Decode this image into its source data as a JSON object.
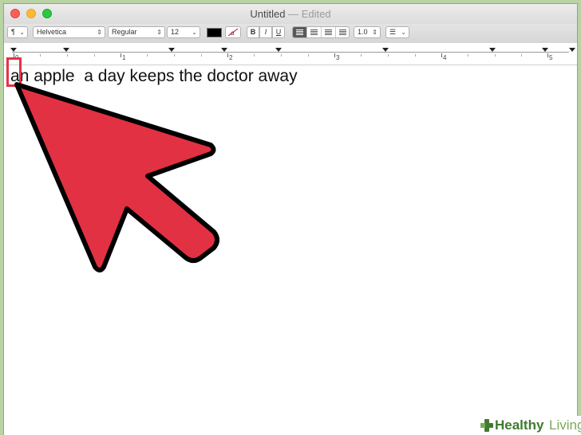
{
  "window": {
    "title": "Untitled",
    "title_separator": "—",
    "title_status": "Edited"
  },
  "toolbar": {
    "paragraph_styles_glyph": "¶",
    "font_family": "Helvetica",
    "font_style": "Regular",
    "font_size": "12",
    "bold_label": "B",
    "italic_label": "I",
    "underline_label": "U",
    "line_spacing": "1.0",
    "text_color": "#000000"
  },
  "ruler": {
    "numbers": [
      "0",
      "1",
      "2",
      "3",
      "4",
      "5"
    ]
  },
  "document": {
    "text_first_char": "a",
    "text_rest": "n apple  a day keeps the doctor away"
  },
  "annotation": {
    "arrow_color": "#e23142",
    "box_color": "#e63246"
  },
  "branding": {
    "name_bold": "Healthy",
    "name_light": "Living",
    "color_primary": "#3e7b2d",
    "color_secondary": "#7aa95b"
  }
}
